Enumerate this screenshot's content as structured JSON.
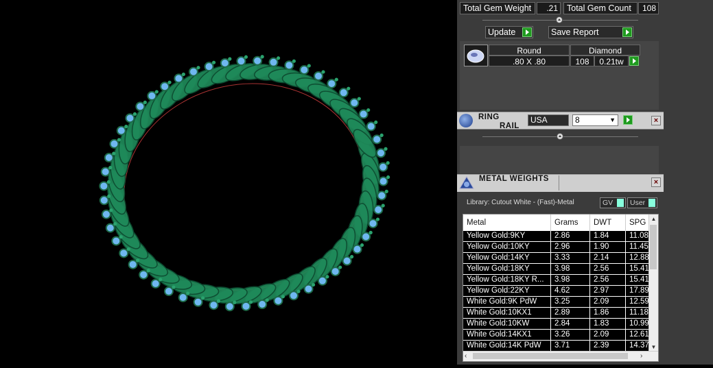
{
  "gems": {
    "total_weight_label": "Total Gem Weight",
    "total_weight_value": ".21",
    "total_count_label": "Total Gem Count",
    "total_count_value": "108",
    "update_label": "Update",
    "save_report_label": "Save Report",
    "row": {
      "shape": "Round",
      "material": "Diamond",
      "size": ".80 X .80",
      "count": "108",
      "weight": "0.21tw"
    }
  },
  "ring_rail": {
    "title_line1": "RING",
    "title_line2": "RAIL",
    "region": "USA",
    "size": "8"
  },
  "metal_weights": {
    "title": "METAL WEIGHTS",
    "library": "Library: Cutout White - (Fast)-Metal",
    "gv_label": "GV",
    "user_label": "User",
    "columns": [
      "Metal",
      "Grams",
      "DWT",
      "SPG"
    ],
    "rows": [
      [
        "Yellow Gold:9KY",
        "2.86",
        "1.84",
        "11.08"
      ],
      [
        "Yellow Gold:10KY",
        "2.96",
        "1.90",
        "11.45"
      ],
      [
        "Yellow Gold:14KY",
        "3.33",
        "2.14",
        "12.88"
      ],
      [
        "Yellow Gold:18KY",
        "3.98",
        "2.56",
        "15.41"
      ],
      [
        "Yellow Gold:18KY R...",
        "3.98",
        "2.56",
        "15.41"
      ],
      [
        "Yellow Gold:22KY",
        "4.62",
        "2.97",
        "17.89"
      ],
      [
        "White Gold:9K PdW",
        "3.25",
        "2.09",
        "12.59"
      ],
      [
        "White Gold:10KX1",
        "2.89",
        "1.86",
        "11.18"
      ],
      [
        "White Gold:10KW",
        "2.84",
        "1.83",
        "10.99"
      ],
      [
        "White Gold:14KX1",
        "3.26",
        "2.09",
        "12.61"
      ],
      [
        "White Gold:14K PdW",
        "3.71",
        "2.39",
        "14.37"
      ]
    ]
  },
  "colors": {
    "ring": "#1f8a5a",
    "gem": "#6fb7f0",
    "go": "#1f9a1f"
  }
}
